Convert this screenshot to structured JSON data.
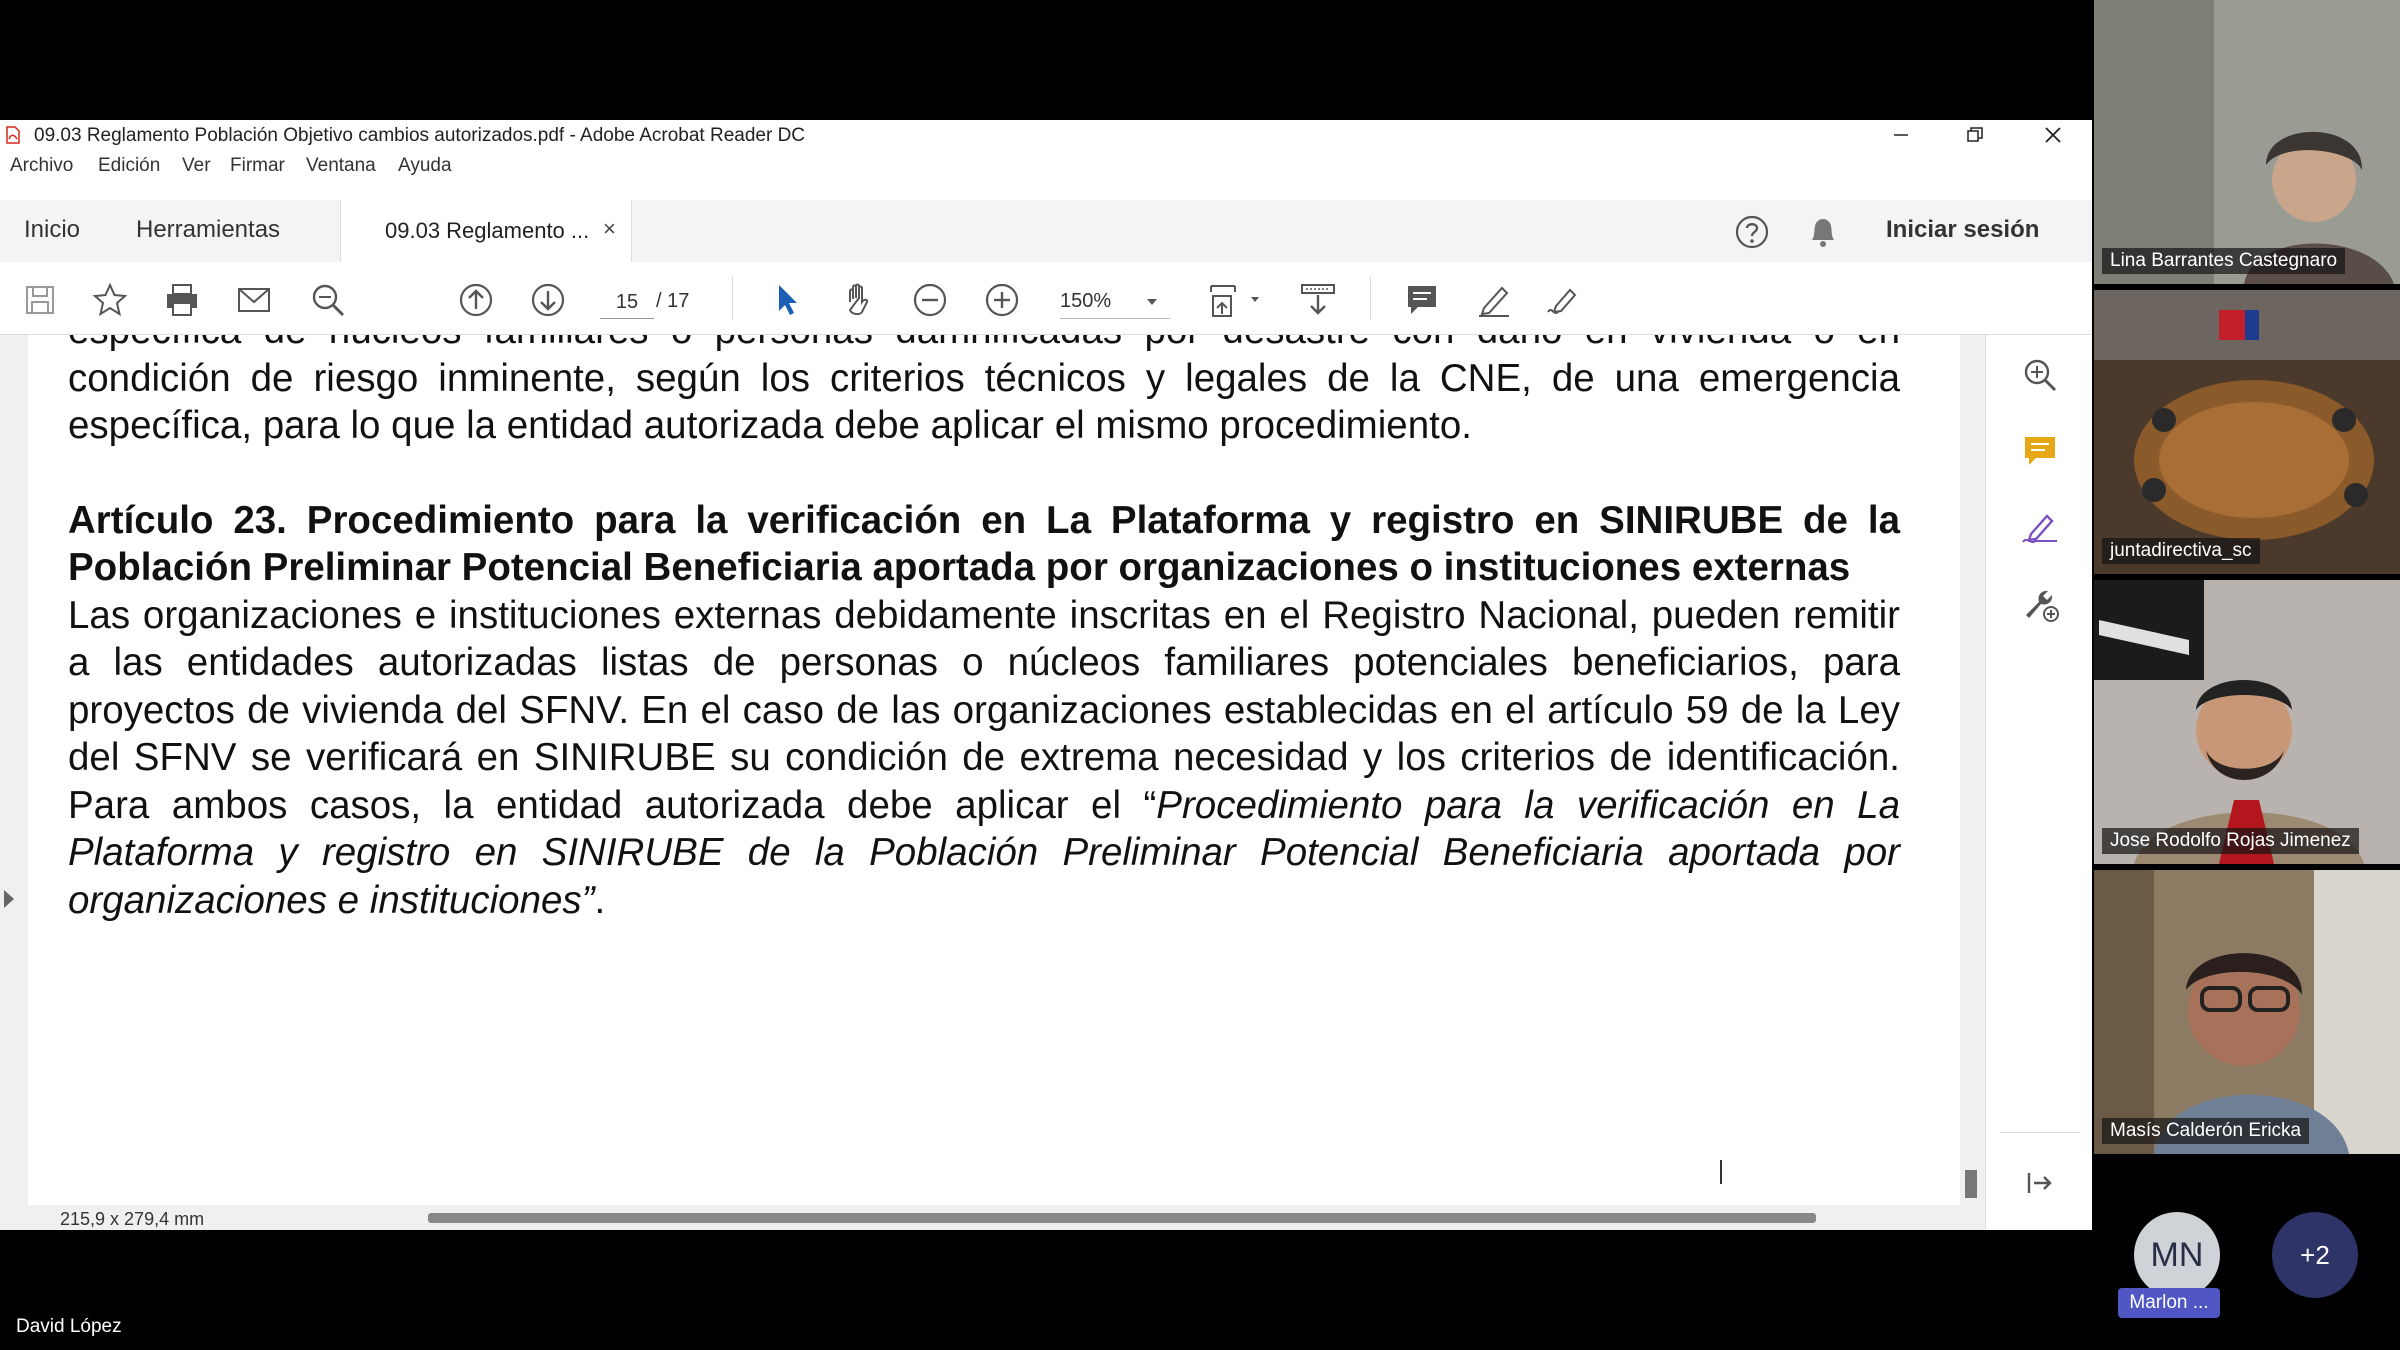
{
  "window": {
    "title": "09.03 Reglamento Población Objetivo cambios autorizados.pdf - Adobe Acrobat Reader DC"
  },
  "menu": [
    "Archivo",
    "Edición",
    "Ver",
    "Firmar",
    "Ventana",
    "Ayuda"
  ],
  "tabs": {
    "home": "Inicio",
    "tools": "Herramientas",
    "document": "09.03 Reglamento ...",
    "close": "×",
    "sign_in": "Iniciar sesión"
  },
  "toolbar": {
    "page_current": "15",
    "page_total": "/  17",
    "zoom": "150%"
  },
  "document": {
    "p1": "específica de núcleos familiares o personas damnificadas por desastre con daño en vivienda o en condición de riesgo inminente, según los criterios técnicos y legales de la CNE, de una emergencia específica, para lo que la entidad autorizada debe aplicar el mismo procedimiento.",
    "heading": "Artículo 23. Procedimiento para la verificación en La Plataforma y registro en SINIRUBE de la Población Preliminar Potencial Beneficiaria aportada por organizaciones o instituciones externas",
    "p2": "Las organizaciones e instituciones externas debidamente inscritas en el Registro Nacional, pueden remitir a las entidades autorizadas listas de personas o núcleos familiares potenciales beneficiarios, para proyectos de vivienda del SFNV. En el caso de las organizaciones establecidas en el artículo 59 de la Ley del SFNV se verificará en SINIRUBE su condición de extrema necesidad y los criterios de identificación. Para ambos casos, la entidad autorizada debe aplicar el “",
    "p2_italic": "Procedimiento para la verificación en La Plataforma y registro en SINIRUBE de la Población Preliminar Potencial Beneficiaria aportada por organizaciones e instituciones”",
    "p2_end": "."
  },
  "status": {
    "page_size": "215,9 x 279,4 mm"
  },
  "participants": [
    {
      "name": "Lina Barrantes Castegnaro"
    },
    {
      "name": "juntadirectiva_sc"
    },
    {
      "name": "Jose Rodolfo Rojas Jimenez"
    },
    {
      "name": "Masís Calderón Ericka"
    }
  ],
  "extra_participant": {
    "initials": "MN",
    "name": "Marlon ..."
  },
  "more_count": "+2",
  "presenter": "David López",
  "colors": {
    "acrobat_red": "#d7261c",
    "select_blue": "#1a5fb4",
    "comment_yellow": "#e6a817",
    "sign_purple": "#7a4fc4",
    "avatar_label": "#5057c4",
    "more_button": "#2e3467"
  }
}
